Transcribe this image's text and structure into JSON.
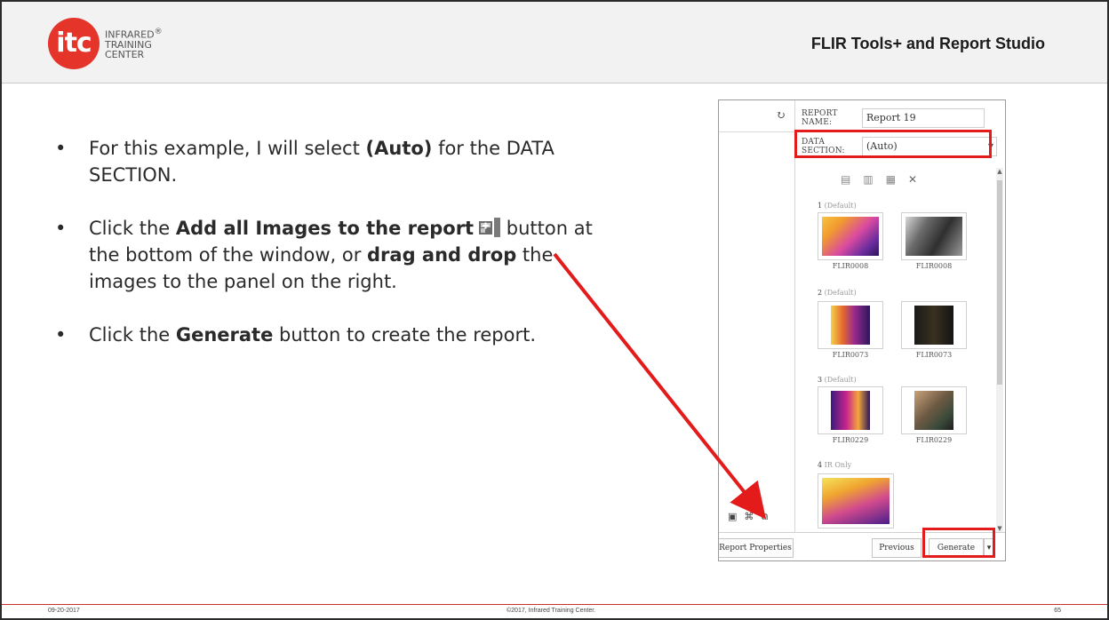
{
  "header": {
    "logo_mark": "itc",
    "logo_lines": [
      "INFRARED",
      "TRAINING",
      "CENTER"
    ],
    "logo_registered": "®",
    "title": "FLIR Tools+ and Report Studio"
  },
  "bullets": {
    "symbol": "•",
    "b1_pre": "For this example, I will select ",
    "b1_bold": "(Auto)",
    "b1_post": " for the DATA SECTION.",
    "b2_pre": "Click the ",
    "b2_bold1": "Add all Images to the report",
    "b2_mid": " button at the bottom of the window, or ",
    "b2_bold2": "drag and drop",
    "b2_post": " the images to the panel on the right.",
    "b3_pre": "Click the ",
    "b3_bold": "Generate",
    "b3_post": " button to create the report."
  },
  "screenshot": {
    "report_name_label": "REPORT NAME:",
    "report_name_value": "Report 19",
    "data_section_label": "DATA SECTION:",
    "data_section_value": "(Auto)",
    "refresh_icon": "refresh-icon",
    "sections": [
      {
        "number": "1",
        "tag": "(Default)",
        "captions": [
          "FLIR0008",
          "FLIR0008"
        ]
      },
      {
        "number": "2",
        "tag": "(Default)",
        "captions": [
          "FLIR0073",
          "FLIR0073"
        ]
      },
      {
        "number": "3",
        "tag": "(Default)",
        "captions": [
          "FLIR0229",
          "FLIR0229"
        ]
      },
      {
        "number": "4",
        "tag": "IR Only",
        "captions": []
      }
    ],
    "buttons": {
      "report_properties": "Report Properties",
      "previous": "Previous",
      "generate": "Generate"
    },
    "highlight_color": "#e31b1b"
  },
  "footer": {
    "date": "09-20-2017",
    "copyright": "©2017, Infrared Training Center.",
    "page": "65"
  },
  "colors": {
    "brand_red": "#e5352b",
    "header_bg": "#f2f2f2",
    "arrow": "#e31b1b"
  }
}
